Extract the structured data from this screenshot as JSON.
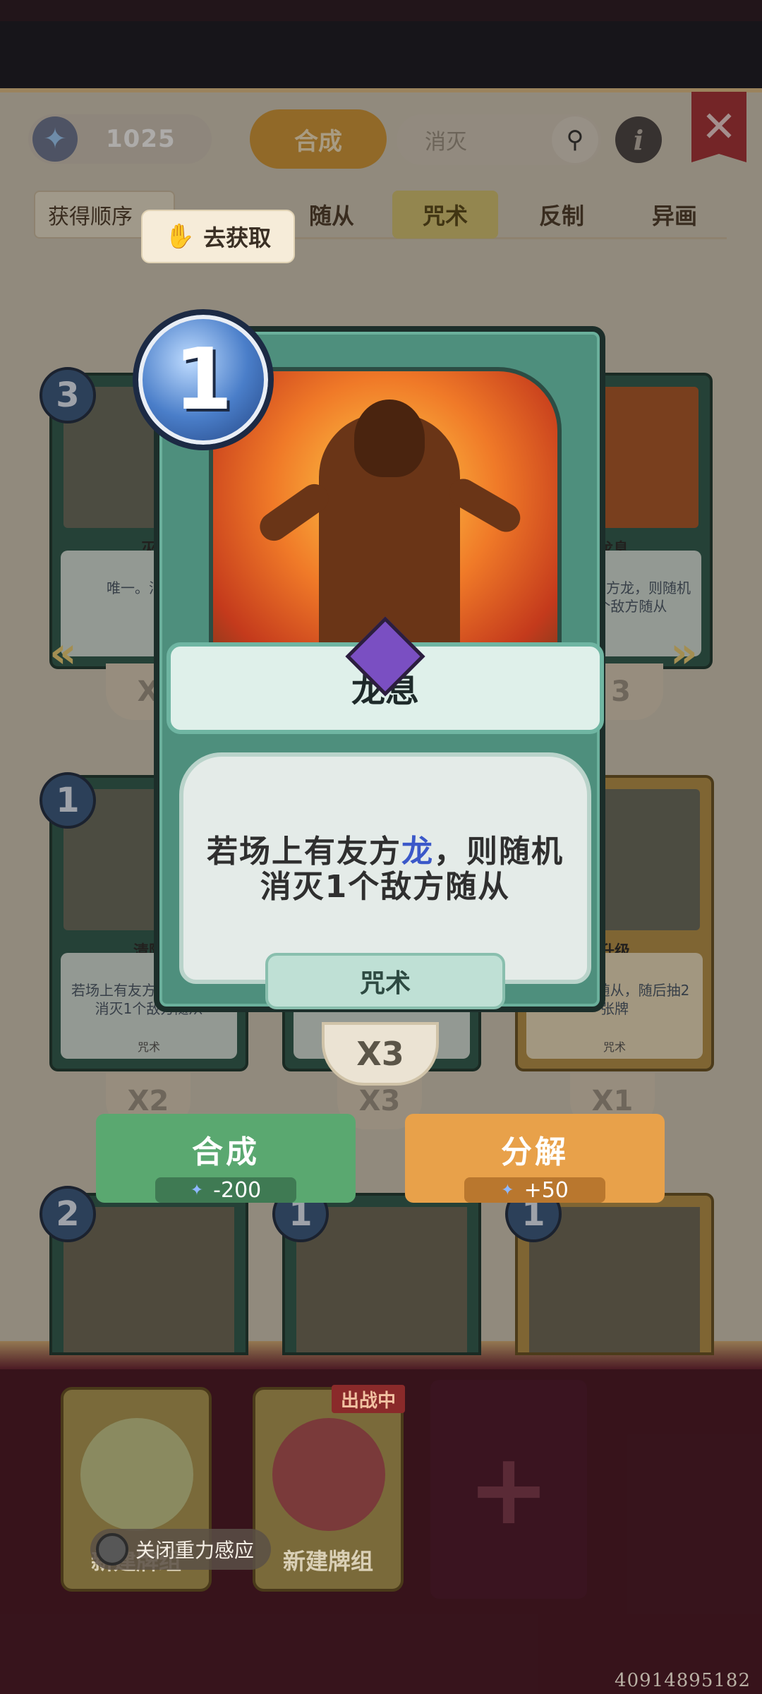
{
  "header": {
    "currency": "1025",
    "craft_tab": "合成",
    "search_placeholder": "消灭",
    "close_icon": "close-icon"
  },
  "filters": {
    "sort_label": "获得顺序",
    "tabs": [
      "随从",
      "咒术",
      "反制",
      "异画"
    ],
    "active_tab": "咒术",
    "get_button": "去获取"
  },
  "background_cards": [
    {
      "cost": "3",
      "name": "灭",
      "desc": "唯一。消灭场",
      "type": "咒术",
      "count": "X"
    },
    {
      "cost": "",
      "name": "龙息",
      "desc": "若场上有友方龙，则随机消灭1个敌方随从",
      "type": "咒术",
      "count": "3"
    },
    {
      "cost": "1",
      "name": "清除",
      "desc": "若场上有友方随从，随机消灭1个敌方随从",
      "type": "咒术",
      "count": "X2"
    },
    {
      "cost": "",
      "name": "",
      "desc": "随后抽2张牌",
      "type": "",
      "count": "X3"
    },
    {
      "cost": "",
      "name": "升级",
      "desc": "发条梦境随从，随后抽2张牌",
      "type": "咒术",
      "count": "X1"
    }
  ],
  "main_card": {
    "cost": "1",
    "title": "龙息",
    "desc_before": "若场上有友方",
    "desc_highlight": "龙",
    "desc_after": "，则随机消灭1个敌方随从",
    "type": "咒术",
    "owned_count": "X3"
  },
  "actions": {
    "craft_label": "合成",
    "craft_cost": "-200",
    "disenchant_label": "分解",
    "disenchant_gain": "+50"
  },
  "bottom_row_costs": [
    "2",
    "1",
    "1"
  ],
  "decks": [
    {
      "label": "新建牌组"
    },
    {
      "label": "新建牌组",
      "badge": "出战中"
    }
  ],
  "gravity_toggle": "关闭重力感应",
  "stamp": "40914895182",
  "colors": {
    "craft_green": "#5aa870",
    "disenchant_orange": "#e8a14a",
    "highlight_blue": "#3b58c9",
    "close_red": "#a83238"
  }
}
